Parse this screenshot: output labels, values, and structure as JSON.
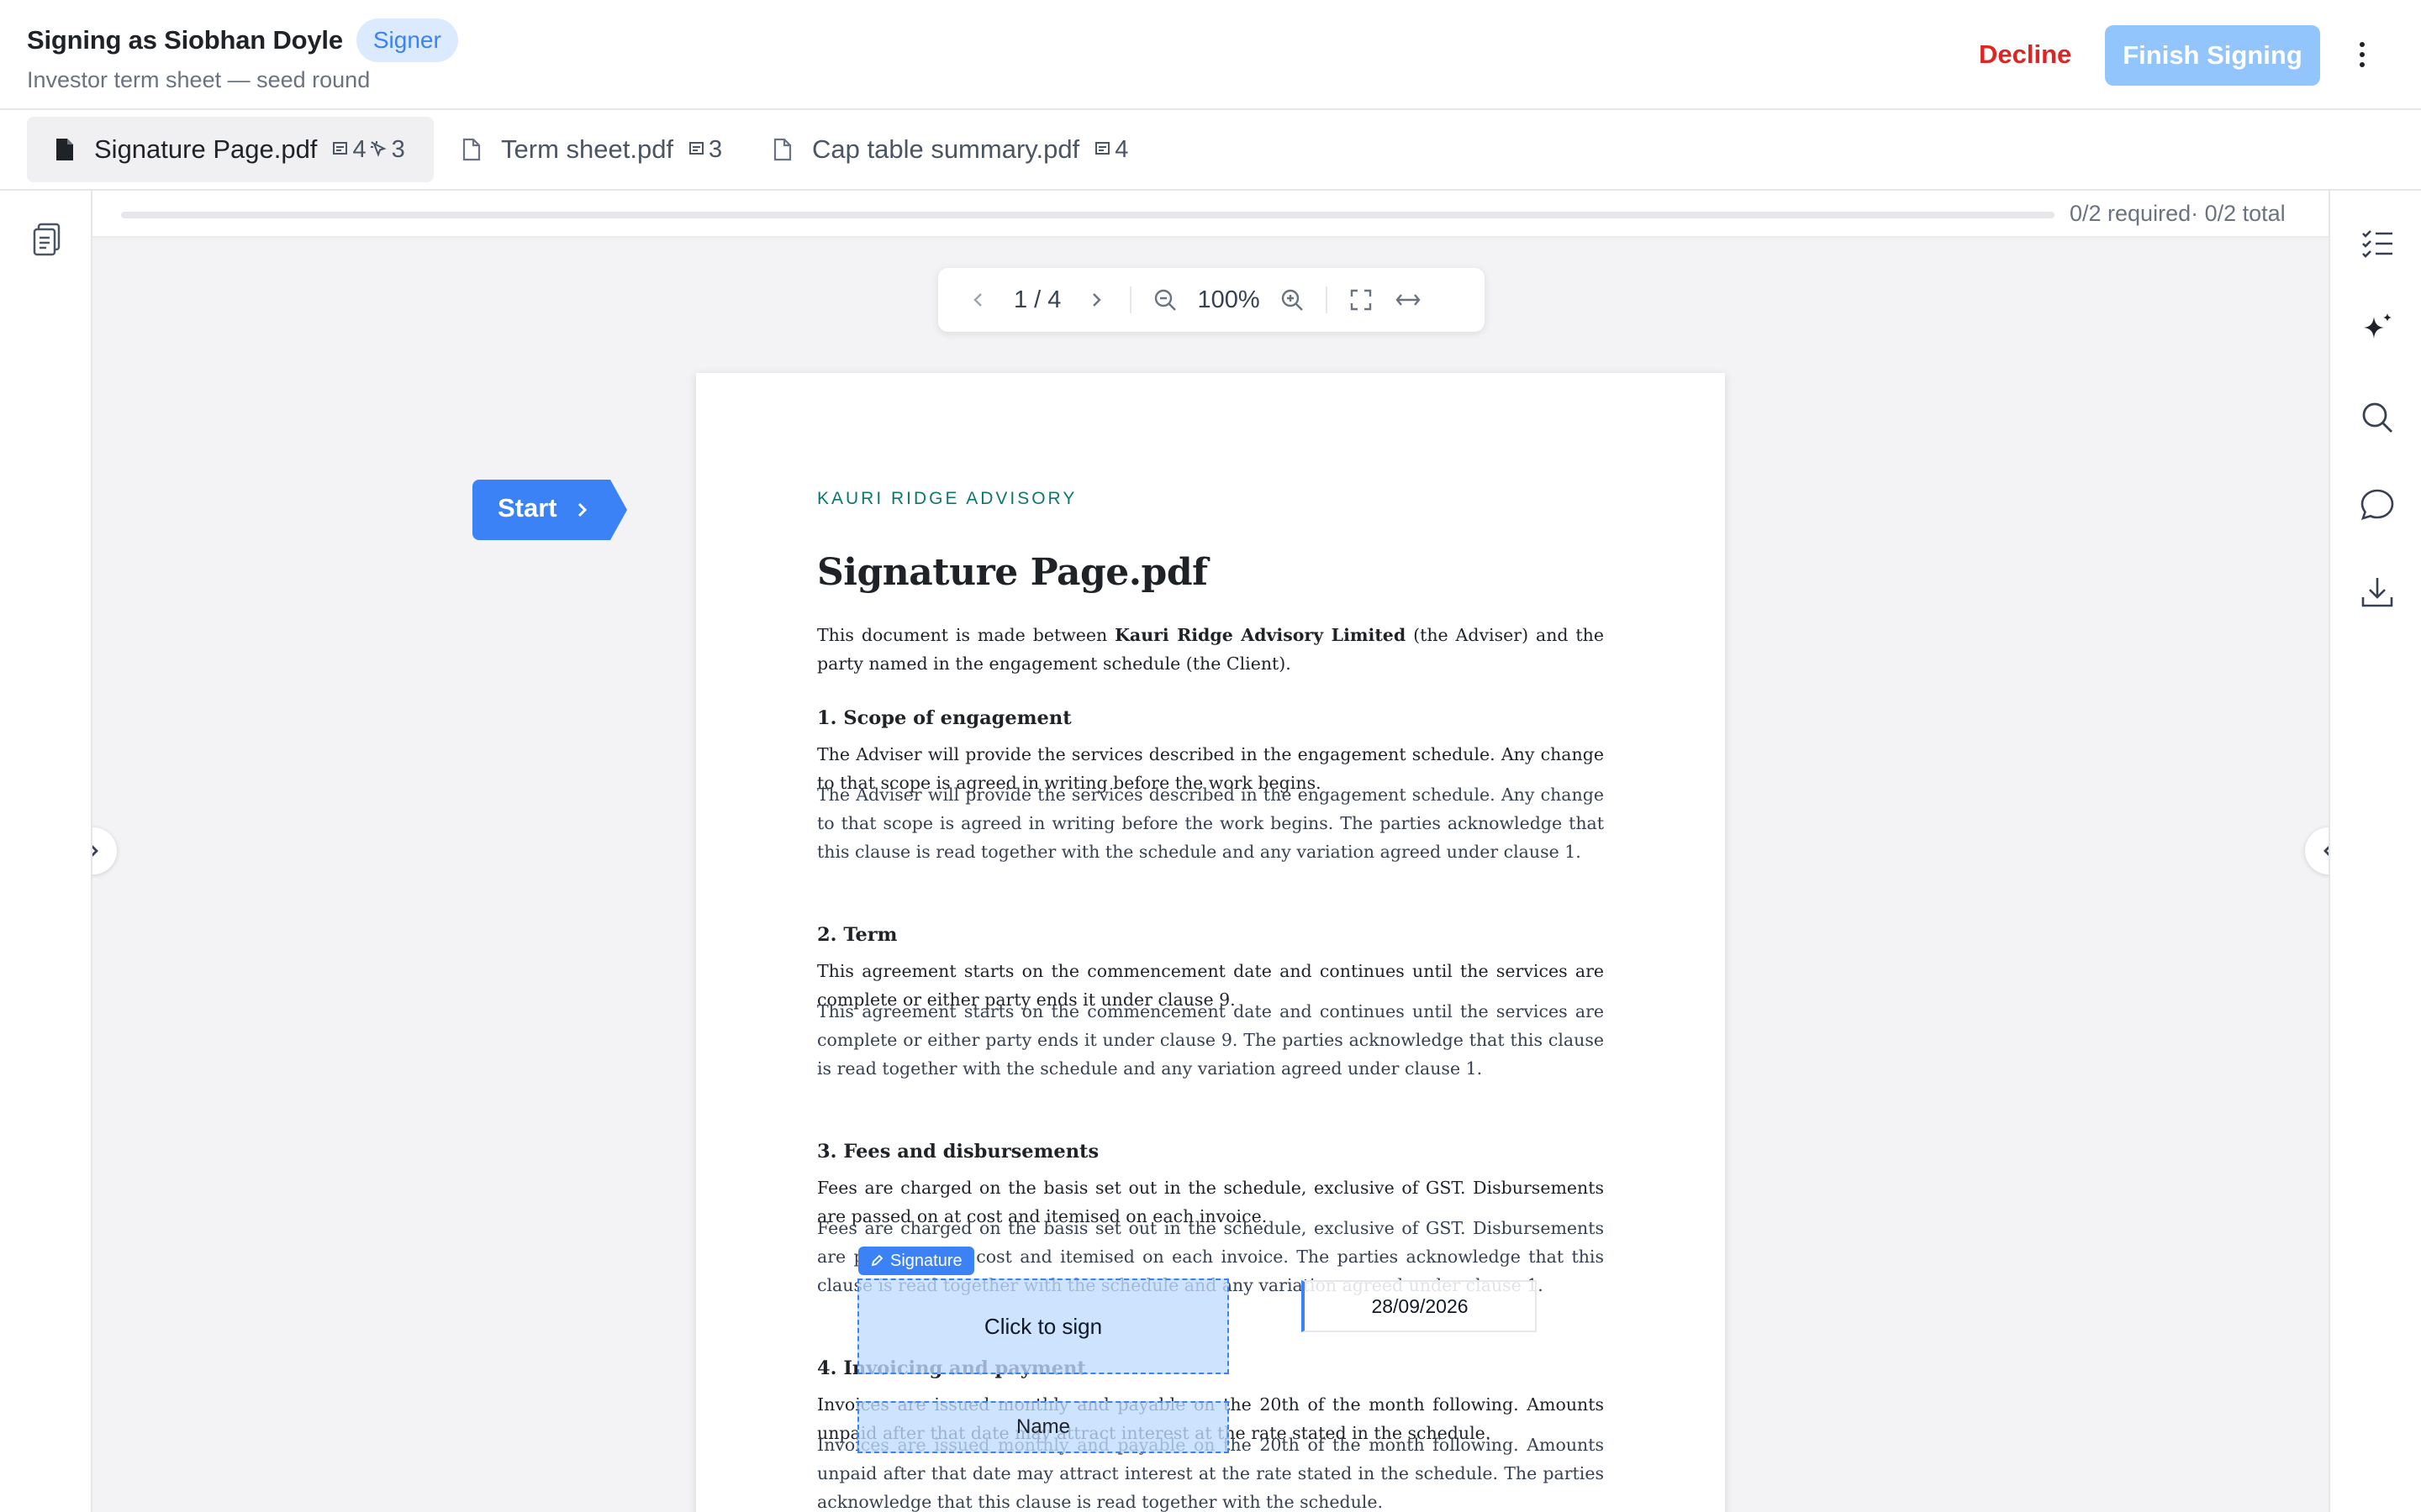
{
  "header": {
    "title": "Signing as Siobhan Doyle",
    "role": "Signer",
    "subtitle": "Investor term sheet — seed round",
    "decline_label": "Decline",
    "finish_label": "Finish Signing"
  },
  "tabs": [
    {
      "label": "Signature Page.pdf",
      "count": "4",
      "count2": "3",
      "active": true
    },
    {
      "label": "Term sheet.pdf",
      "count": "3",
      "active": false
    },
    {
      "label": "Cap table summary.pdf",
      "count": "4",
      "active": false
    }
  ],
  "progress": {
    "text": "0/2 required· 0/2 total",
    "fraction": 0
  },
  "toolbar": {
    "page_indicator": "1 / 4",
    "zoom": "100%"
  },
  "start_label": "Start",
  "document": {
    "brand": "KAURI RIDGE ADVISORY",
    "title": "Signature Page.pdf",
    "intro_pre": "This document is made between ",
    "intro_bold": "Kauri Ridge Advisory Limited",
    "intro_post": " (the Adviser) and the party named in the engagement schedule (the Client).",
    "sections": [
      {
        "heading": "1. Scope of engagement",
        "p1": "The Adviser will provide the services described in the engagement schedule. Any change to that scope is agreed in writing before the work begins.",
        "p2": "The Adviser will provide the services described in the engagement schedule. Any change to that scope is agreed in writing before the work begins. The parties acknowledge that this clause is read together with the schedule and any variation agreed under clause 1."
      },
      {
        "heading": "2. Term",
        "p1": "This agreement starts on the commencement date and continues until the services are complete or either party ends it under clause 9.",
        "p2": "This agreement starts on the commencement date and continues until the services are complete or either party ends it under clause 9. The parties acknowledge that this clause is read together with the schedule and any variation agreed under clause 1."
      },
      {
        "heading": "3. Fees and disbursements",
        "p1": "Fees are charged on the basis set out in the schedule, exclusive of GST. Disbursements are passed on at cost and itemised on each invoice.",
        "p2": "Fees are charged on the basis set out in the schedule, exclusive of GST. Disbursements are passed on at cost and itemised on each invoice. The parties acknowledge that this clause is read together with the schedule and any variation agreed under clause 1."
      },
      {
        "heading": "4. Invoicing and payment",
        "p1": "Invoices are issued monthly and payable on the 20th of the month following. Amounts unpaid after that date may attract interest at the rate stated in the schedule.",
        "p2": "Invoices are issued monthly and payable on the 20th of the month following. Amounts unpaid after that date may attract interest at the rate stated in the schedule. The parties acknowledge that this clause is read together with the schedule."
      }
    ]
  },
  "fields": {
    "signature_tag": "Signature",
    "signature_placeholder": "Click to sign",
    "name_placeholder": "Name",
    "date_value": "28/09/2026"
  },
  "colors": {
    "accent": "#3b82f6",
    "decline": "#dc2626",
    "finish_disabled": "#93c5fd",
    "brand": "#0f766e"
  }
}
